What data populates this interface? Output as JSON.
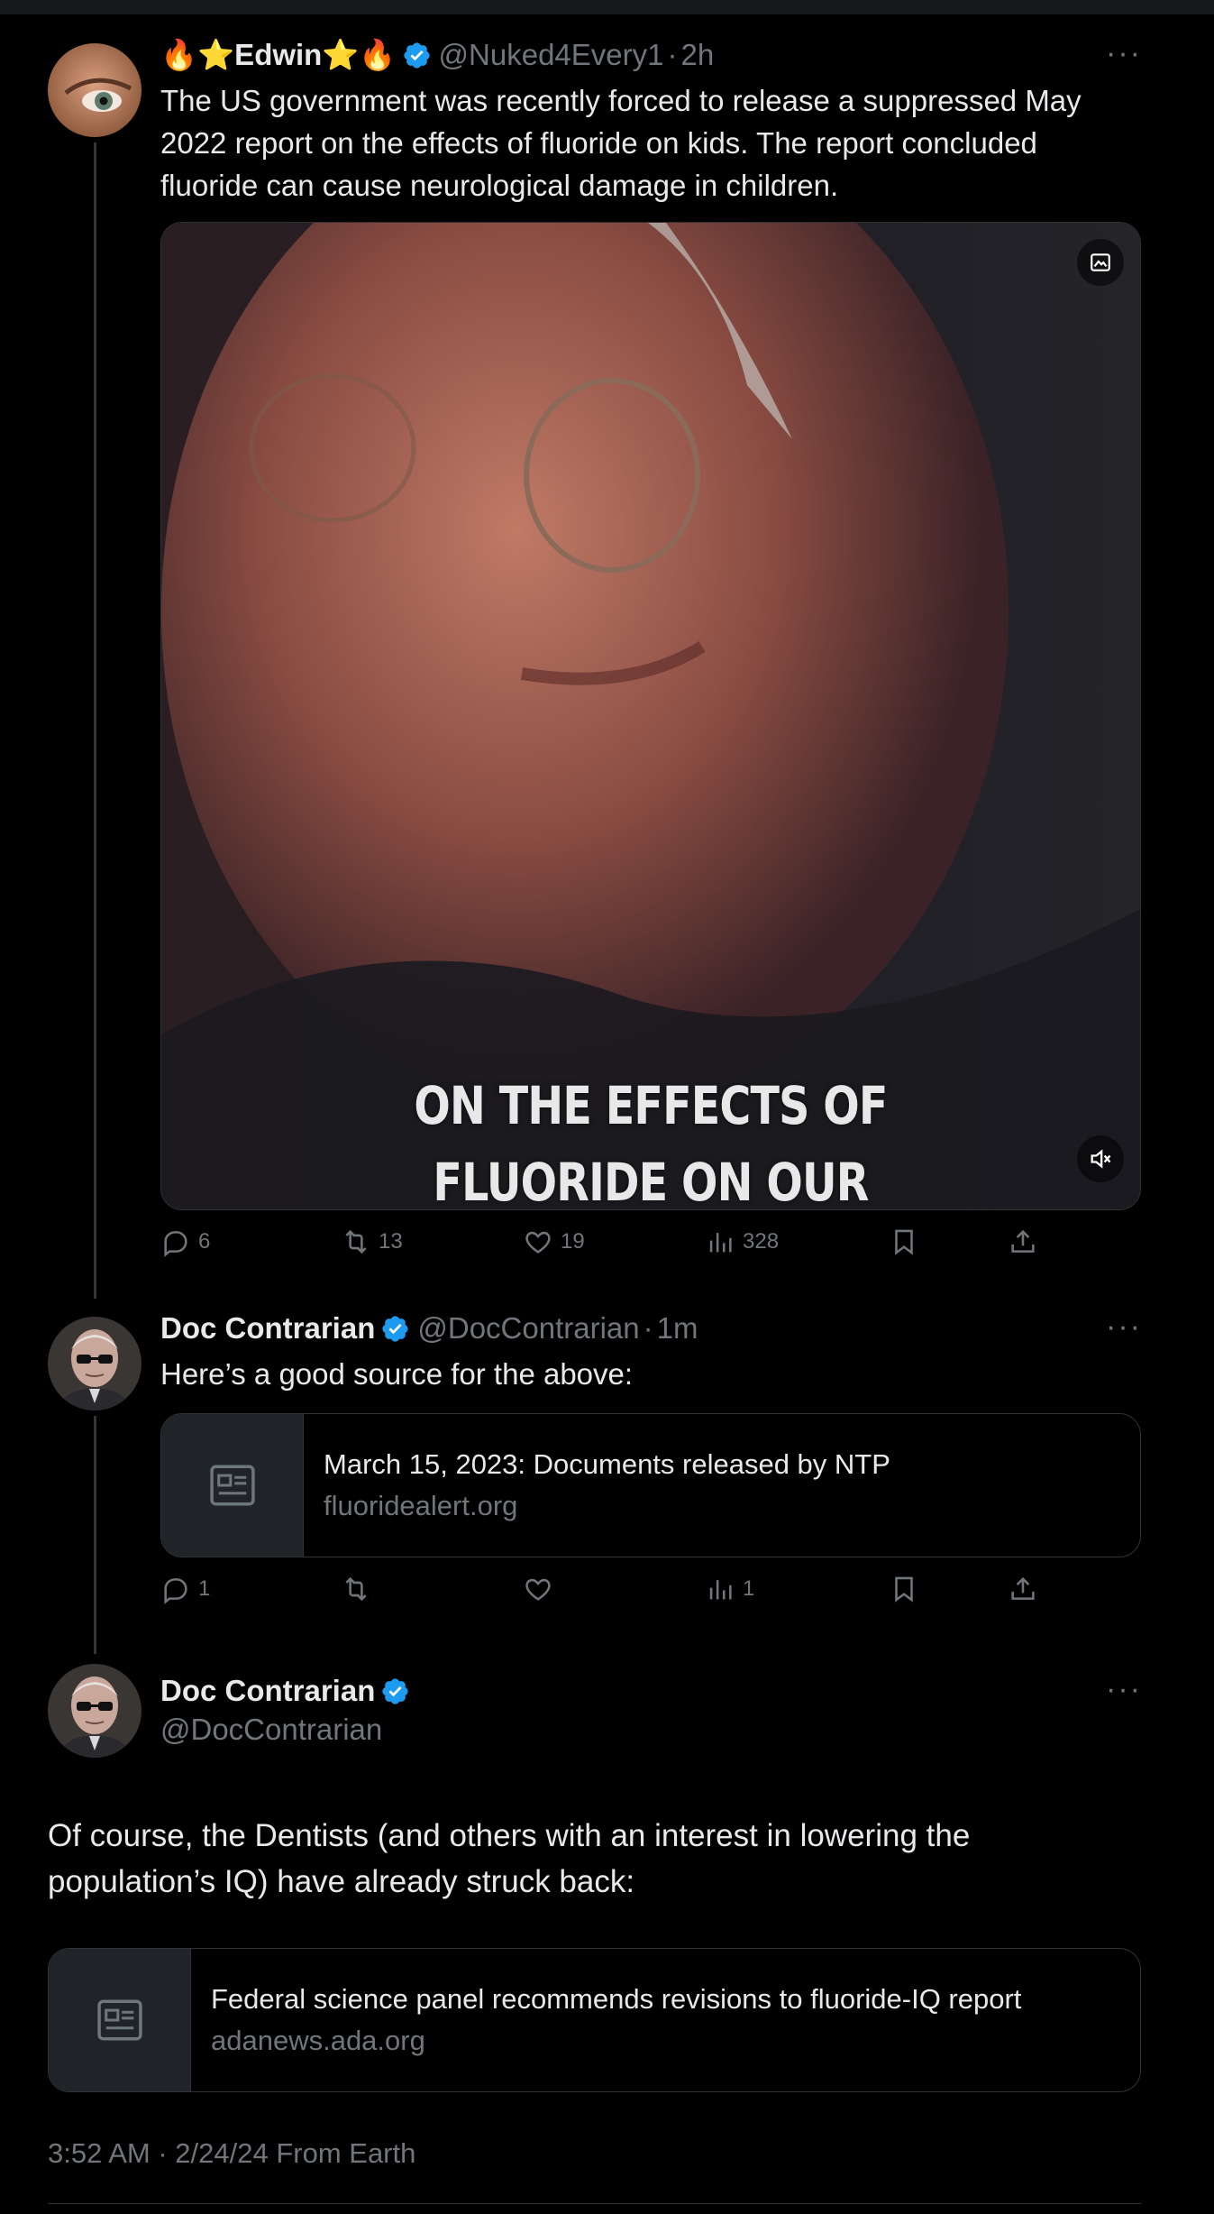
{
  "tweet1": {
    "display_name": "🔥⭐Edwin⭐🔥",
    "handle": "@Nuked4Every1",
    "separator": "·",
    "time": "2h",
    "text_line1": "The US government was recently forced to release a suppressed May",
    "text_line2": "2022 report on the effects of fluoride on kids. The report concluded",
    "text_line3": "fluoride can cause neurological damage in children.",
    "video_caption_line1": "ON THE EFFECTS OF",
    "video_caption_line2": "FLUORIDE ON OUR",
    "replies": "6",
    "reposts": "13",
    "likes": "19",
    "views": "328"
  },
  "tweet2": {
    "display_name": "Doc Contrarian",
    "handle": "@DocContrarian",
    "separator": "·",
    "time": "1m",
    "text": "Here’s a good source for the above:",
    "card_title": "March 15, 2023: Documents released by NTP",
    "card_domain": "fluoridealert.org",
    "replies": "1",
    "views": "1"
  },
  "main_tweet": {
    "display_name": "Doc Contrarian",
    "handle": "@DocContrarian",
    "text_line1": "Of course, the Dentists (and others with an interest in lowering the",
    "text_line2": "population’s IQ) have already struck back:",
    "card_title": "Federal science panel recommends revisions to fluoride-IQ report",
    "card_domain": "adanews.ada.org",
    "timestamp": "3:52 AM · 2/24/24 From Earth"
  },
  "more_label": "···",
  "icons": [
    "reply-icon",
    "repost-icon",
    "like-icon",
    "views-icon",
    "bookmark-icon",
    "share-icon",
    "verified-icon",
    "more-icon",
    "mute-icon",
    "image-icon"
  ],
  "colors": {
    "background": "#000000",
    "verified": "#1d9bf0",
    "text": "#e7e9ea",
    "secondary": "#71767b"
  }
}
